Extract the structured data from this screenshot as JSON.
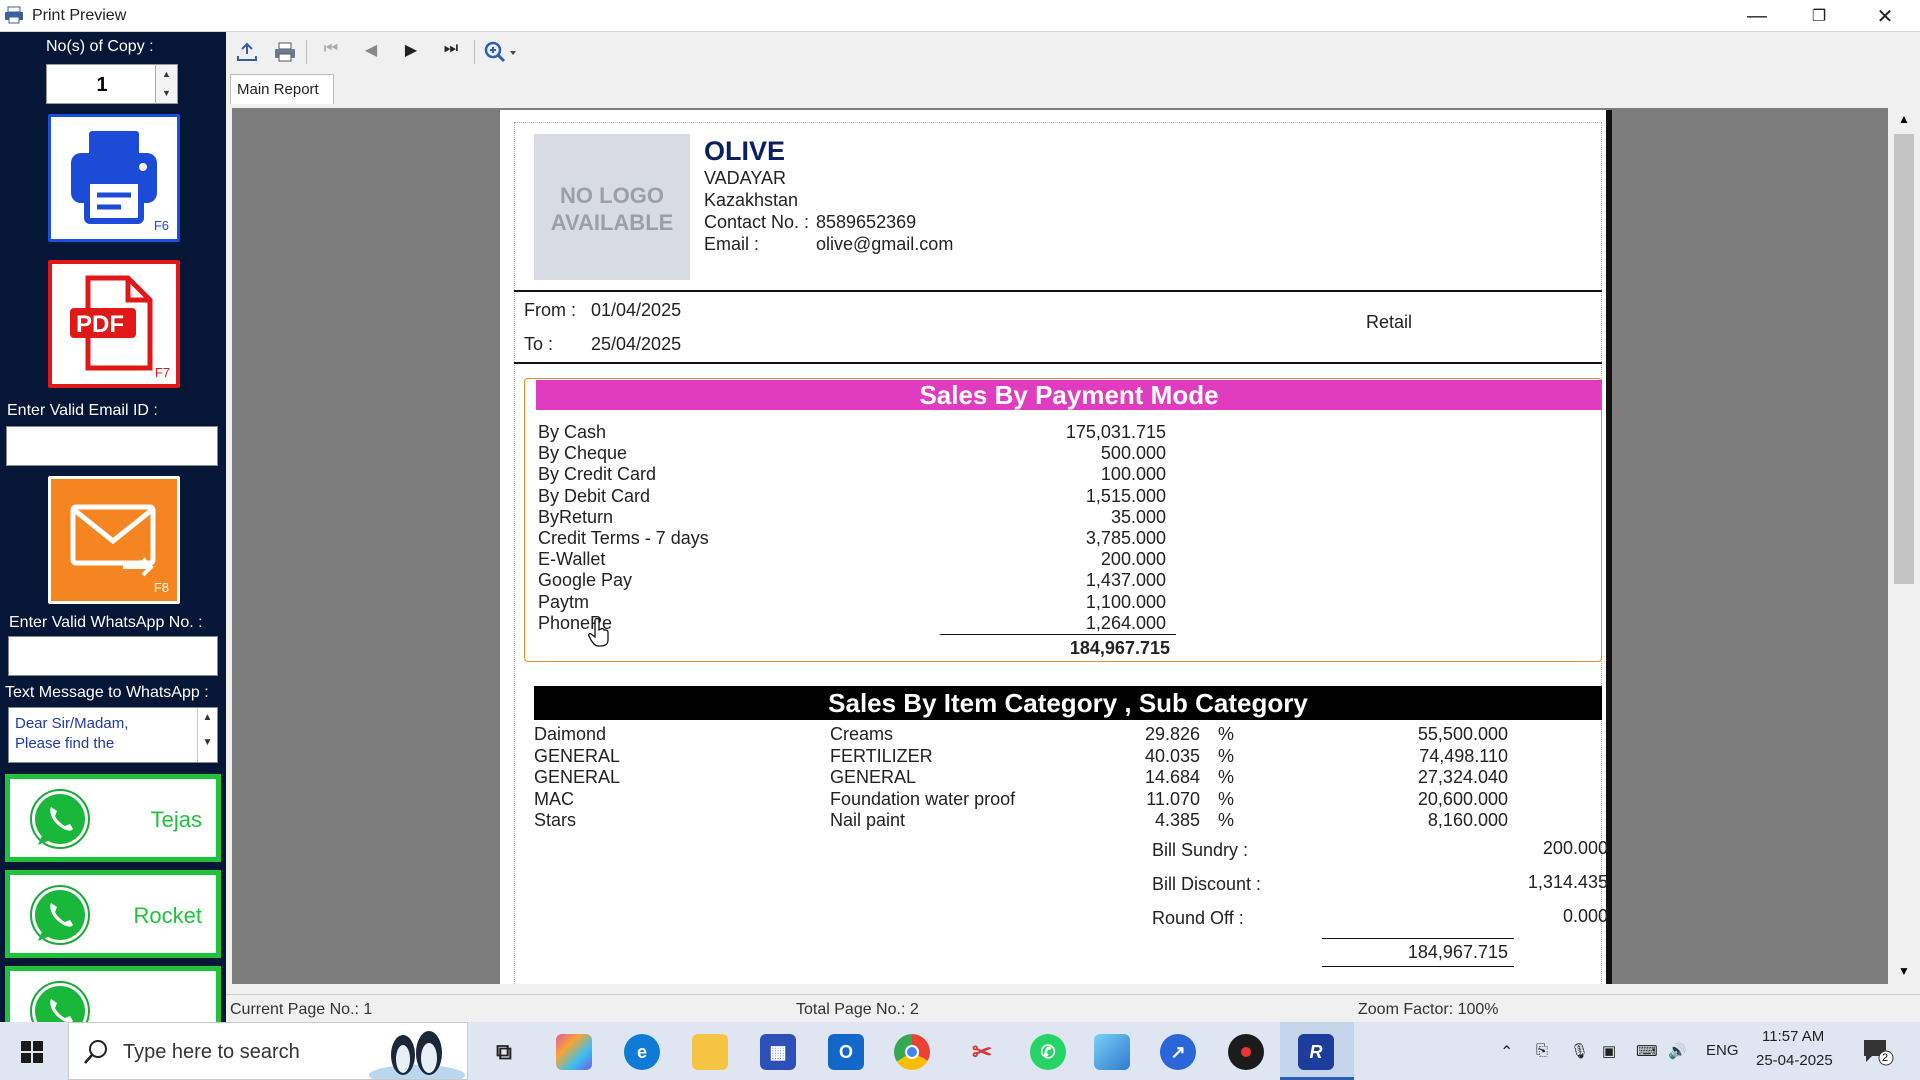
{
  "window": {
    "title": "Print Preview",
    "min_glyph": "—",
    "restore_glyph": "❐",
    "close_glyph": "✕"
  },
  "left_panel": {
    "copies_label": "No(s) of Copy :",
    "copies_value": "1",
    "print_hotkey": "F6",
    "pdf_label": "PDF",
    "pdf_hotkey": "F7",
    "email_label": "Enter Valid Email ID :",
    "email_value": "",
    "email_hotkey": "F8",
    "whatsapp_label": "Enter Valid WhatsApp No. :",
    "whatsapp_value": "",
    "message_label": "Text Message to WhatsApp :",
    "message_text_1": "Dear Sir/Madam,",
    "message_text_2": "Please find the",
    "whatsapp_buttons": [
      "Tejas",
      "Rocket"
    ]
  },
  "toolbar": {
    "tab_label": "Main Report"
  },
  "report": {
    "logo_text_1": "NO LOGO",
    "logo_text_2": "AVAILABLE",
    "company_name": "OLIVE",
    "address_1": "VADAYAR",
    "address_2": "Kazakhstan",
    "contact_label": "Contact No. :",
    "contact_value": "8589652369",
    "email_label": "Email :",
    "email_value": "olive@gmail.com",
    "from_label": "From :",
    "from_date": "01/04/2025",
    "to_label": "To :",
    "to_date": "25/04/2025",
    "type_label": "Retail",
    "payment_title": "Sales By Payment Mode",
    "payment_rows": [
      {
        "mode": "By Cash",
        "amount": "175,031.715"
      },
      {
        "mode": "By Cheque",
        "amount": "500.000"
      },
      {
        "mode": "By Credit Card",
        "amount": "100.000"
      },
      {
        "mode": "By Debit Card",
        "amount": "1,515.000"
      },
      {
        "mode": "ByReturn",
        "amount": "35.000"
      },
      {
        "mode": "Credit Terms - 7 days",
        "amount": "3,785.000"
      },
      {
        "mode": "E-Wallet",
        "amount": "200.000"
      },
      {
        "mode": "Google Pay",
        "amount": "1,437.000"
      },
      {
        "mode": "Paytm",
        "amount": "1,100.000"
      },
      {
        "mode": "PhonePe",
        "amount": "1,264.000"
      }
    ],
    "payment_total": "184,967.715",
    "category_title": "Sales By Item Category , Sub Category",
    "category_rows": [
      {
        "category": "Daimond",
        "sub": "Creams",
        "pct": "29.826",
        "sym": "%",
        "amount": "55,500.000"
      },
      {
        "category": "GENERAL",
        "sub": "FERTILIZER",
        "pct": "40.035",
        "sym": "%",
        "amount": "74,498.110"
      },
      {
        "category": "GENERAL",
        "sub": "GENERAL",
        "pct": "14.684",
        "sym": "%",
        "amount": "27,324.040"
      },
      {
        "category": "MAC",
        "sub": "Foundation water proof",
        "pct": "11.070",
        "sym": "%",
        "amount": "20,600.000"
      },
      {
        "category": "Stars",
        "sub": "Nail paint",
        "pct": "4.385",
        "sym": "%",
        "amount": "8,160.000"
      }
    ],
    "bill_sundry_label": "Bill Sundry :",
    "bill_sundry_value": "200.000",
    "bill_discount_label": "Bill Discount :",
    "bill_discount_value": "1,314.435",
    "round_off_label": "Round Off :",
    "round_off_value": "0.000",
    "grand_total": "184,967.715"
  },
  "status_bar": {
    "current_page": "Current Page No.: 1",
    "total_page": "Total Page No.: 2",
    "zoom": "Zoom Factor: 100%"
  },
  "taskbar": {
    "search_placeholder": "Type here to search",
    "language": "ENG",
    "time": "11:57 AM",
    "date": "25-04-2025",
    "notification_count": "2"
  },
  "colors": {
    "panel_bg": "#061637",
    "payment_header": "#e03cc0",
    "category_header": "#000000",
    "whatsapp_green": "#1fc33a"
  }
}
